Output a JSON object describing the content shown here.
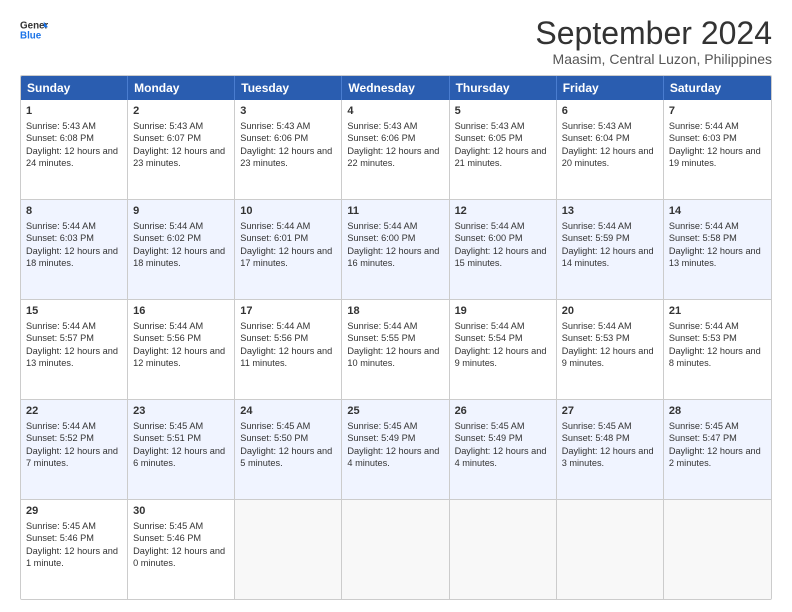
{
  "header": {
    "logo_line1": "General",
    "logo_line2": "Blue",
    "title": "September 2024",
    "subtitle": "Maasim, Central Luzon, Philippines"
  },
  "calendar": {
    "days": [
      "Sunday",
      "Monday",
      "Tuesday",
      "Wednesday",
      "Thursday",
      "Friday",
      "Saturday"
    ],
    "rows": [
      [
        {
          "day": "1",
          "sunrise": "5:43 AM",
          "sunset": "6:08 PM",
          "daylight": "12 hours and 24 minutes."
        },
        {
          "day": "2",
          "sunrise": "5:43 AM",
          "sunset": "6:07 PM",
          "daylight": "12 hours and 23 minutes."
        },
        {
          "day": "3",
          "sunrise": "5:43 AM",
          "sunset": "6:06 PM",
          "daylight": "12 hours and 23 minutes."
        },
        {
          "day": "4",
          "sunrise": "5:43 AM",
          "sunset": "6:06 PM",
          "daylight": "12 hours and 22 minutes."
        },
        {
          "day": "5",
          "sunrise": "5:43 AM",
          "sunset": "6:05 PM",
          "daylight": "12 hours and 21 minutes."
        },
        {
          "day": "6",
          "sunrise": "5:43 AM",
          "sunset": "6:04 PM",
          "daylight": "12 hours and 20 minutes."
        },
        {
          "day": "7",
          "sunrise": "5:44 AM",
          "sunset": "6:03 PM",
          "daylight": "12 hours and 19 minutes."
        }
      ],
      [
        {
          "day": "8",
          "sunrise": "5:44 AM",
          "sunset": "6:03 PM",
          "daylight": "12 hours and 18 minutes."
        },
        {
          "day": "9",
          "sunrise": "5:44 AM",
          "sunset": "6:02 PM",
          "daylight": "12 hours and 18 minutes."
        },
        {
          "day": "10",
          "sunrise": "5:44 AM",
          "sunset": "6:01 PM",
          "daylight": "12 hours and 17 minutes."
        },
        {
          "day": "11",
          "sunrise": "5:44 AM",
          "sunset": "6:00 PM",
          "daylight": "12 hours and 16 minutes."
        },
        {
          "day": "12",
          "sunrise": "5:44 AM",
          "sunset": "6:00 PM",
          "daylight": "12 hours and 15 minutes."
        },
        {
          "day": "13",
          "sunrise": "5:44 AM",
          "sunset": "5:59 PM",
          "daylight": "12 hours and 14 minutes."
        },
        {
          "day": "14",
          "sunrise": "5:44 AM",
          "sunset": "5:58 PM",
          "daylight": "12 hours and 13 minutes."
        }
      ],
      [
        {
          "day": "15",
          "sunrise": "5:44 AM",
          "sunset": "5:57 PM",
          "daylight": "12 hours and 13 minutes."
        },
        {
          "day": "16",
          "sunrise": "5:44 AM",
          "sunset": "5:56 PM",
          "daylight": "12 hours and 12 minutes."
        },
        {
          "day": "17",
          "sunrise": "5:44 AM",
          "sunset": "5:56 PM",
          "daylight": "12 hours and 11 minutes."
        },
        {
          "day": "18",
          "sunrise": "5:44 AM",
          "sunset": "5:55 PM",
          "daylight": "12 hours and 10 minutes."
        },
        {
          "day": "19",
          "sunrise": "5:44 AM",
          "sunset": "5:54 PM",
          "daylight": "12 hours and 9 minutes."
        },
        {
          "day": "20",
          "sunrise": "5:44 AM",
          "sunset": "5:53 PM",
          "daylight": "12 hours and 9 minutes."
        },
        {
          "day": "21",
          "sunrise": "5:44 AM",
          "sunset": "5:53 PM",
          "daylight": "12 hours and 8 minutes."
        }
      ],
      [
        {
          "day": "22",
          "sunrise": "5:44 AM",
          "sunset": "5:52 PM",
          "daylight": "12 hours and 7 minutes."
        },
        {
          "day": "23",
          "sunrise": "5:45 AM",
          "sunset": "5:51 PM",
          "daylight": "12 hours and 6 minutes."
        },
        {
          "day": "24",
          "sunrise": "5:45 AM",
          "sunset": "5:50 PM",
          "daylight": "12 hours and 5 minutes."
        },
        {
          "day": "25",
          "sunrise": "5:45 AM",
          "sunset": "5:49 PM",
          "daylight": "12 hours and 4 minutes."
        },
        {
          "day": "26",
          "sunrise": "5:45 AM",
          "sunset": "5:49 PM",
          "daylight": "12 hours and 4 minutes."
        },
        {
          "day": "27",
          "sunrise": "5:45 AM",
          "sunset": "5:48 PM",
          "daylight": "12 hours and 3 minutes."
        },
        {
          "day": "28",
          "sunrise": "5:45 AM",
          "sunset": "5:47 PM",
          "daylight": "12 hours and 2 minutes."
        }
      ],
      [
        {
          "day": "29",
          "sunrise": "5:45 AM",
          "sunset": "5:46 PM",
          "daylight": "12 hours and 1 minute."
        },
        {
          "day": "30",
          "sunrise": "5:45 AM",
          "sunset": "5:46 PM",
          "daylight": "12 hours and 0 minutes."
        },
        null,
        null,
        null,
        null,
        null
      ]
    ]
  }
}
